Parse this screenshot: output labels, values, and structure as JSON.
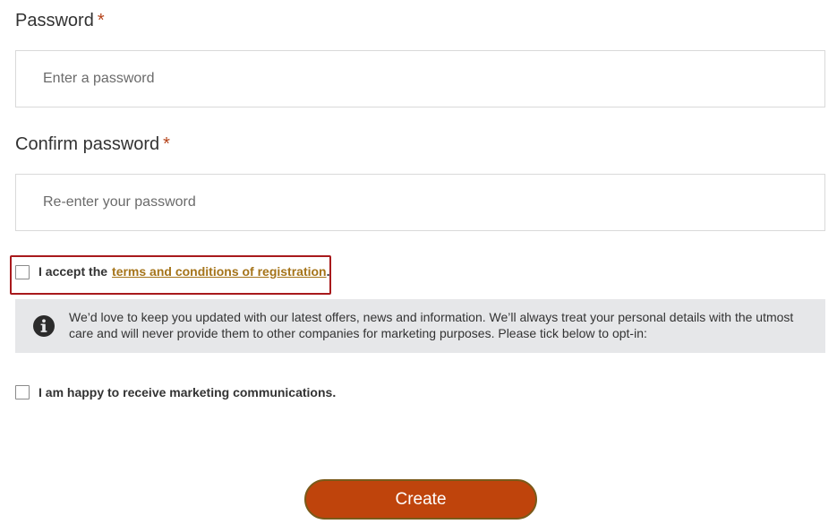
{
  "password": {
    "label": "Password",
    "required_mark": "*",
    "placeholder": "Enter a password",
    "value": ""
  },
  "confirm_password": {
    "label": "Confirm password",
    "required_mark": "*",
    "placeholder": "Re-enter your password",
    "value": ""
  },
  "terms": {
    "text": "I accept the",
    "link_text": "terms and conditions of registration",
    "suffix": ".",
    "checked": false
  },
  "info": {
    "icon": "info-icon",
    "text": "We’d love to keep you updated with our latest offers, news and information. We’ll always treat your personal details with the utmost care and will never provide them to other companies for marketing purposes. Please tick below to opt-in:"
  },
  "marketing": {
    "text": "I am happy to receive marketing communications.",
    "checked": false
  },
  "submit": {
    "label": "Create"
  },
  "colors": {
    "accent": "#bf440c",
    "required": "#b5431a",
    "link": "#a5741a",
    "highlight_border": "#a8191c",
    "info_background": "#e6e7e9"
  }
}
